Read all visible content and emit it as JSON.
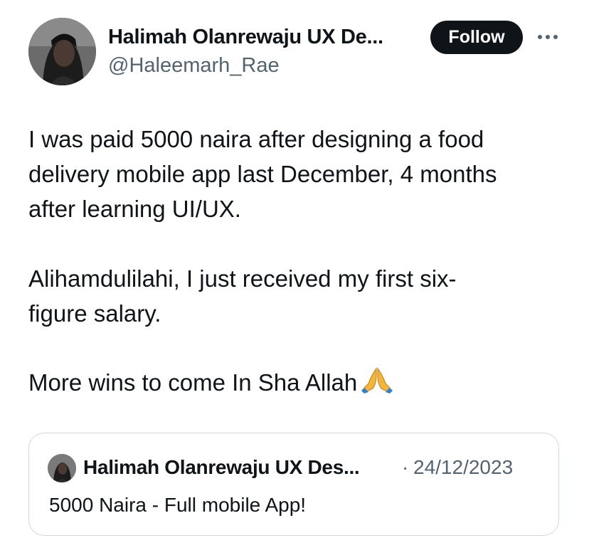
{
  "author": {
    "name": "Halimah Olanrewaju UX De...",
    "handle": "@Haleemarh_Rae"
  },
  "follow_label": "Follow",
  "more_icon": "more-horizontal-icon",
  "tweet": {
    "lines": [
      "I was paid 5000 naira after designing  a food",
      "delivery mobile app last December, 4 months",
      "after learning  UI/UX.",
      "Alihamdulilahi, I just received my first six-",
      "figure salary.",
      "More wins to come In Sha Allah"
    ],
    "emoji": "folded-hands-icon"
  },
  "quote": {
    "author_name": "Halimah Olanrewaju UX Des...",
    "separator": "·",
    "date": "24/12/2023",
    "text": "5000 Naira - Full mobile App!"
  },
  "colors": {
    "text": "#0f1419",
    "secondary": "#536471",
    "follow_bg": "#0f1419",
    "border": "#cfd9de",
    "emoji": "#f4b63a"
  }
}
